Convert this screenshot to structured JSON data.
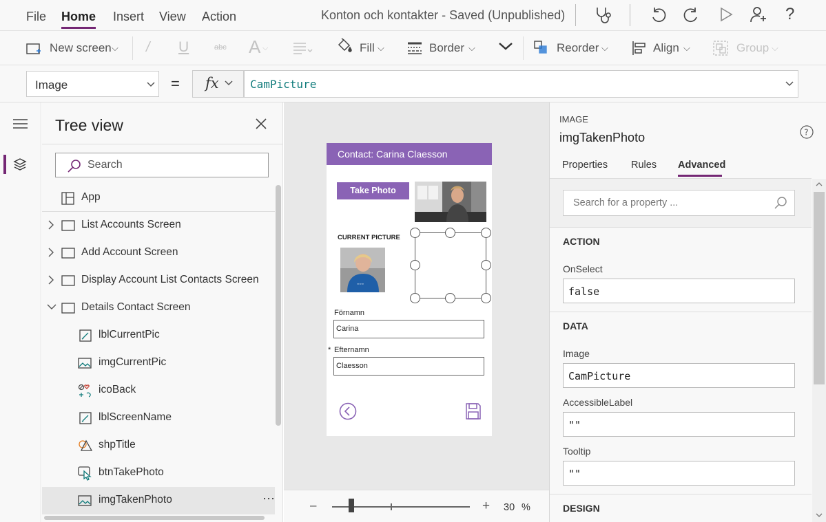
{
  "menu": {
    "items": [
      "File",
      "Home",
      "Insert",
      "View",
      "Action"
    ],
    "active": "Home",
    "doc_title": "Konton och kontakter - Saved (Unpublished)",
    "accent": "#742774"
  },
  "ribbon": {
    "new_screen": "New screen",
    "fill": "Fill",
    "border": "Border",
    "reorder": "Reorder",
    "align": "Align",
    "group": "Group"
  },
  "formula_bar": {
    "property": "Image",
    "equals": "=",
    "fx": "fx",
    "formula": "CamPicture"
  },
  "tree": {
    "title": "Tree view",
    "search_placeholder": "Search",
    "items": [
      {
        "label": "App",
        "icon": "app-icon"
      },
      {
        "label": "List Accounts Screen",
        "icon": "screen-icon"
      },
      {
        "label": "Add Account Screen",
        "icon": "screen-icon"
      },
      {
        "label": "Display Account List Contacts Screen",
        "icon": "screen-icon"
      },
      {
        "label": "Details Contact Screen",
        "icon": "screen-icon"
      },
      {
        "label": "lblCurrentPic",
        "icon": "label-icon"
      },
      {
        "label": "imgCurrentPic",
        "icon": "image-icon"
      },
      {
        "label": "icoBack",
        "icon": "icon-control-icon"
      },
      {
        "label": "lblScreenName",
        "icon": "label-icon"
      },
      {
        "label": "shpTitle",
        "icon": "shape-icon"
      },
      {
        "label": "btnTakePhoto",
        "icon": "button-icon"
      },
      {
        "label": "imgTakenPhoto",
        "icon": "image-icon"
      }
    ],
    "more": "···"
  },
  "canvas": {
    "header": "Contact: Carina Claesson",
    "take_photo": "Take Photo",
    "current_picture": "CURRENT PICTURE",
    "fornamn_label": "Förnamn",
    "fornamn_value": "Carina",
    "required_mark": "*",
    "efternamn_label": "Efternamn",
    "efternamn_value": "Claesson",
    "brand_color": "#8a63b5"
  },
  "zoom": {
    "minus": "–",
    "plus": "+",
    "value": "30",
    "unit": "%",
    "level_fraction": 0.14
  },
  "properties": {
    "type": "IMAGE",
    "name": "imgTakenPhoto",
    "tabs": [
      "Properties",
      "Rules",
      "Advanced"
    ],
    "active_tab": "Advanced",
    "search_placeholder": "Search for a property ...",
    "sections": {
      "action": "ACTION",
      "data": "DATA",
      "design": "DESIGN"
    },
    "onselect_label": "OnSelect",
    "onselect_value": "false",
    "image_label": "Image",
    "image_value": "CamPicture",
    "accessible_label": "AccessibleLabel",
    "accessible_value": "\"\"",
    "tooltip_label": "Tooltip",
    "tooltip_value": "\"\""
  }
}
